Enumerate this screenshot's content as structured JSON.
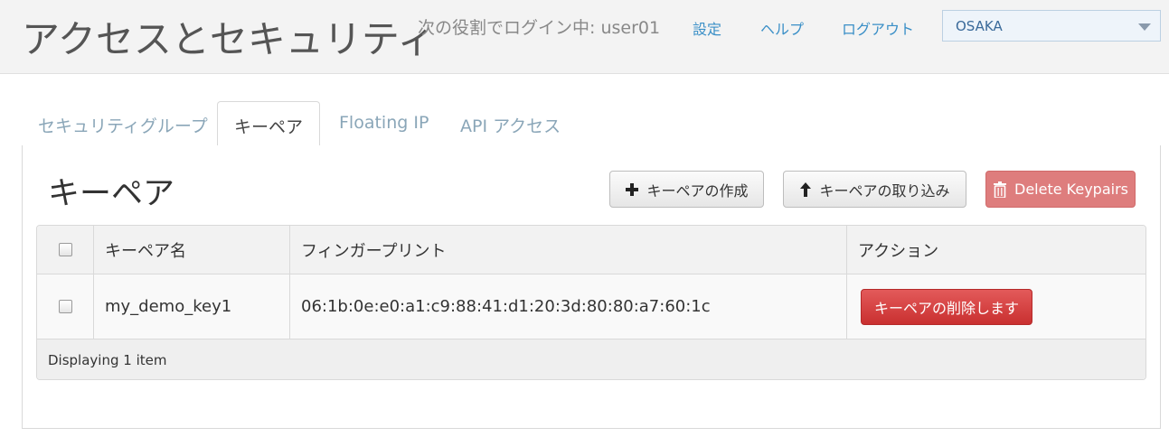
{
  "header": {
    "title": "アクセスとセキュリティ",
    "login_status": "次の役割でログイン中: user01",
    "links": {
      "settings": "設定",
      "help": "ヘルプ",
      "logout": "ログアウト"
    },
    "region": "OSAKA"
  },
  "tabs": {
    "security_groups": "セキュリティグループ",
    "keypairs": "キーペア",
    "floating_ip": "Floating IP",
    "api_access": "API アクセス"
  },
  "section": {
    "title": "キーペア",
    "create_button": "キーペアの作成",
    "import_button": "キーペアの取り込み",
    "delete_button": "Delete Keypairs"
  },
  "table": {
    "headers": {
      "name": "キーペア名",
      "fingerprint": "フィンガープリント",
      "actions": "アクション"
    },
    "rows": [
      {
        "name": "my_demo_key1",
        "fingerprint": "06:1b:0e:e0:a1:c9:88:41:d1:20:3d:80:80:a7:60:1c",
        "action": "キーペアの削除します"
      }
    ],
    "footer": "Displaying 1 item"
  },
  "colors": {
    "link": "#3a8fc7",
    "danger": "#c93030",
    "danger_light": "#de7d7d"
  }
}
